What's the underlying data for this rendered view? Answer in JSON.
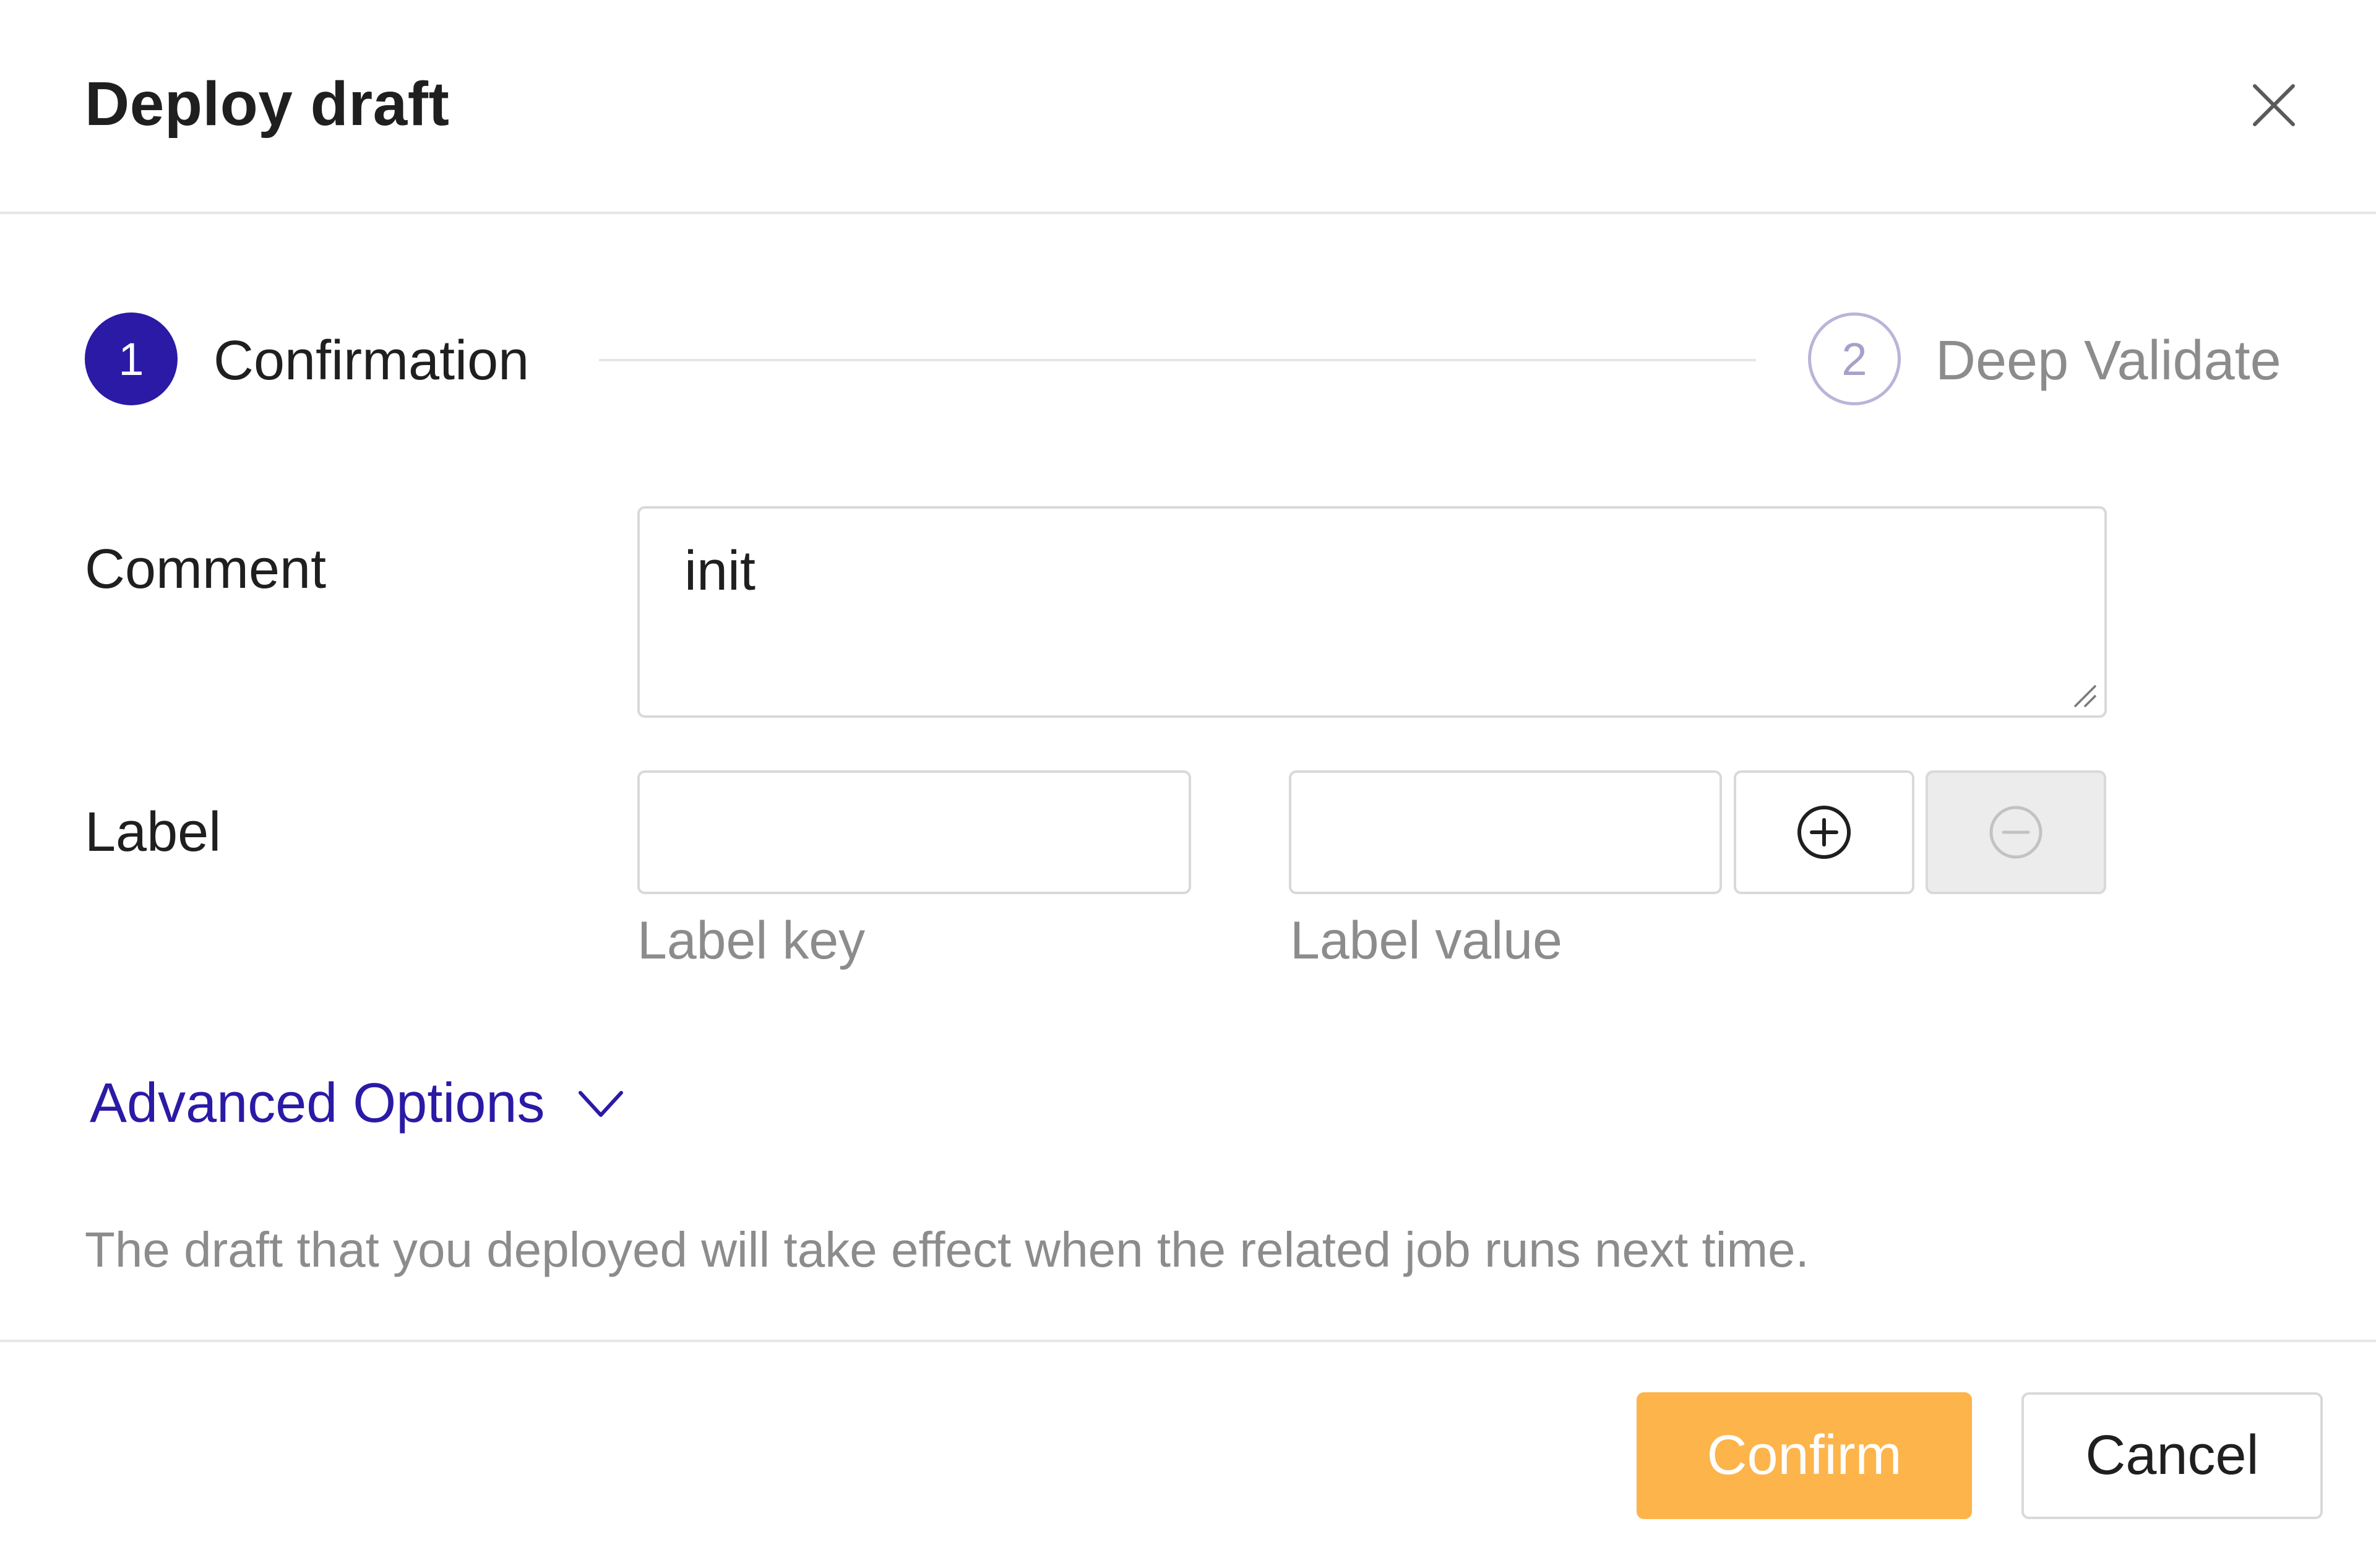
{
  "dialog": {
    "title": "Deploy draft",
    "close_icon": "close-icon"
  },
  "steps": [
    {
      "number": "1",
      "label": "Confirmation",
      "state": "active"
    },
    {
      "number": "2",
      "label": "Deep Validate",
      "state": "pending"
    }
  ],
  "form": {
    "comment": {
      "label": "Comment",
      "value": "init"
    },
    "label": {
      "label": "Label",
      "key_value": "",
      "key_hint": "Label key",
      "value_value": "",
      "value_hint": "Label value",
      "add_icon": "plus-circle-icon",
      "remove_icon": "minus-circle-icon"
    }
  },
  "advanced": {
    "label": "Advanced Options",
    "icon": "chevron-down-icon"
  },
  "notice": "The draft that you deployed will take effect when the related job runs next time.",
  "footer": {
    "confirm_label": "Confirm",
    "cancel_label": "Cancel"
  },
  "colors": {
    "accent": "#2a1aa5",
    "confirm": "#fdb44b",
    "muted_text": "#8c8c8c",
    "border": "#d9d9d9"
  }
}
